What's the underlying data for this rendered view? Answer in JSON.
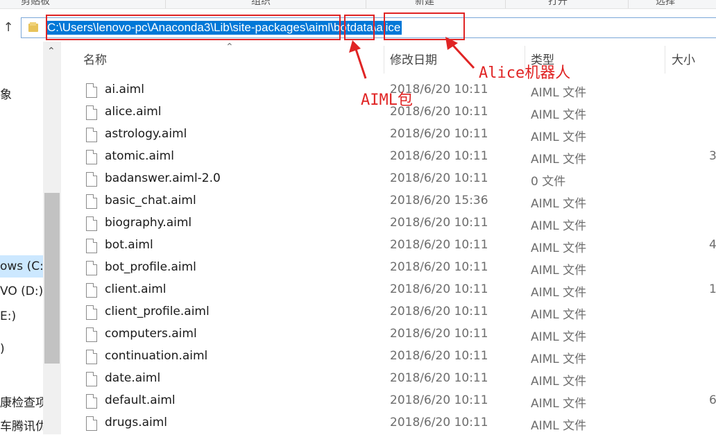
{
  "ribbon": {
    "groups": [
      "剪贴板",
      "组织",
      "新建",
      "打开",
      "选择"
    ]
  },
  "address_bar": {
    "path": "C:\\Users\\lenovo-pc\\Anaconda3\\Lib\\site-packages\\aiml\\botdata\\alice"
  },
  "nav_pane": {
    "items": [
      "象",
      "ows (C:)",
      "VO (D:)",
      "E:)",
      ")",
      "康检查项",
      "车腾讯优"
    ]
  },
  "columns": {
    "name": "名称",
    "date": "修改日期",
    "type": "类型",
    "size": "大小"
  },
  "files": [
    {
      "name": "ai.aiml",
      "date": "2018/6/20 10:11",
      "type": "AIML 文件",
      "size": ""
    },
    {
      "name": "alice.aiml",
      "date": "2018/6/20 10:11",
      "type": "AIML 文件",
      "size": ""
    },
    {
      "name": "astrology.aiml",
      "date": "2018/6/20 10:11",
      "type": "AIML 文件",
      "size": ""
    },
    {
      "name": "atomic.aiml",
      "date": "2018/6/20 10:11",
      "type": "AIML 文件",
      "size": "3"
    },
    {
      "name": "badanswer.aiml-2.0",
      "date": "2018/6/20 10:11",
      "type": "0 文件",
      "size": ""
    },
    {
      "name": "basic_chat.aiml",
      "date": "2018/6/20 15:36",
      "type": "AIML 文件",
      "size": ""
    },
    {
      "name": "biography.aiml",
      "date": "2018/6/20 10:11",
      "type": "AIML 文件",
      "size": ""
    },
    {
      "name": "bot.aiml",
      "date": "2018/6/20 10:11",
      "type": "AIML 文件",
      "size": "4"
    },
    {
      "name": "bot_profile.aiml",
      "date": "2018/6/20 10:11",
      "type": "AIML 文件",
      "size": ""
    },
    {
      "name": "client.aiml",
      "date": "2018/6/20 10:11",
      "type": "AIML 文件",
      "size": "1"
    },
    {
      "name": "client_profile.aiml",
      "date": "2018/6/20 10:11",
      "type": "AIML 文件",
      "size": ""
    },
    {
      "name": "computers.aiml",
      "date": "2018/6/20 10:11",
      "type": "AIML 文件",
      "size": ""
    },
    {
      "name": "continuation.aiml",
      "date": "2018/6/20 10:11",
      "type": "AIML 文件",
      "size": ""
    },
    {
      "name": "date.aiml",
      "date": "2018/6/20 10:11",
      "type": "AIML 文件",
      "size": ""
    },
    {
      "name": "default.aiml",
      "date": "2018/6/20 10:11",
      "type": "AIML 文件",
      "size": "6"
    },
    {
      "name": "drugs.aiml",
      "date": "2018/6/20 10:11",
      "type": "AIML 文件",
      "size": ""
    }
  ],
  "annotations": {
    "aiml_label": "AIML包",
    "alice_label": "Alice机器人",
    "color": "#e02424"
  },
  "colors": {
    "selection": "#0078d7",
    "nav_selected": "#cce8ff"
  }
}
